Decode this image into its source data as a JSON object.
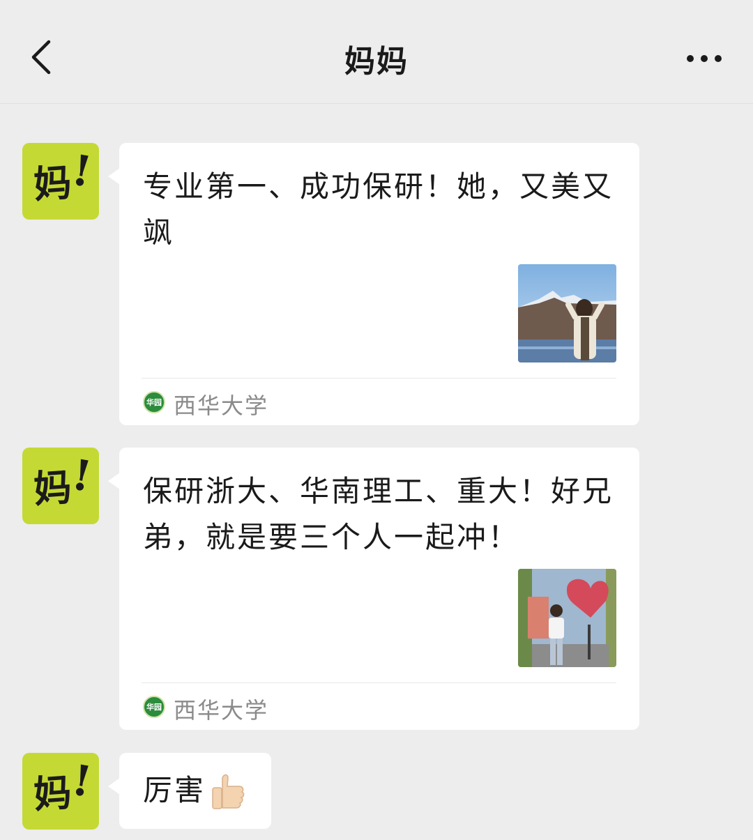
{
  "header": {
    "title": "妈妈",
    "back_icon": "chevron-left-icon",
    "more_icon": "more-dots-icon"
  },
  "contact": {
    "avatar_text": "妈",
    "avatar_bang": "!",
    "avatar_color": "#c5d934"
  },
  "messages": [
    {
      "type": "article-card",
      "text": "专业第一、成功保研！她，又美又飒",
      "thumbnail": "photo-woman-mountain",
      "source_icon_text": "华园",
      "source": "西华大学"
    },
    {
      "type": "article-card",
      "text": "保研浙大、华南理工、重大！好兄弟，就是要三个人一起冲！",
      "thumbnail": "photo-man-heart-sign",
      "source_icon_text": "华园",
      "source": "西华大学"
    },
    {
      "type": "text",
      "text": "厉害",
      "emoji": "thumbs-up-icon"
    }
  ],
  "colors": {
    "background": "#ededed",
    "bubble": "#ffffff",
    "source_icon": "#2a8c3c"
  }
}
